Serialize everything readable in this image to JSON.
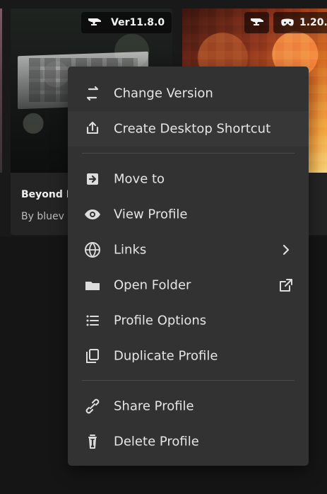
{
  "background_cards": {
    "left_card": {
      "version_badge": "Ver11.8.0",
      "title": "Beyond I",
      "author": "By bluev"
    },
    "right_card": {
      "version_badge": "1.20."
    }
  },
  "context_menu": {
    "change_version": "Change Version",
    "create_desktop_shortcut": "Create Desktop Shortcut",
    "move_to": "Move to",
    "view_profile": "View Profile",
    "links": "Links",
    "open_folder": "Open Folder",
    "profile_options": "Profile Options",
    "duplicate_profile": "Duplicate Profile",
    "share_profile": "Share Profile",
    "delete_profile": "Delete Profile"
  },
  "icons": {
    "change_version": "swap-icon",
    "create_desktop_shortcut": "upload-icon",
    "move_to": "move-arrow-icon",
    "view_profile": "eye-icon",
    "links": "globe-icon",
    "links_chevron": "chevron-right-icon",
    "open_folder": "folder-icon",
    "open_folder_external": "external-link-icon",
    "profile_options": "list-icon",
    "duplicate_profile": "duplicate-icon",
    "share_profile": "share-icon",
    "delete_profile": "trash-icon",
    "left_badge": "anvil-icon",
    "right_badge_1": "anvil-icon",
    "right_badge_2": "mask-icon"
  },
  "colors": {
    "menu_background": "#323232",
    "menu_highlight": "#373737",
    "menu_divider": "#4a4a4a",
    "text_primary": "#e5e5e5"
  }
}
